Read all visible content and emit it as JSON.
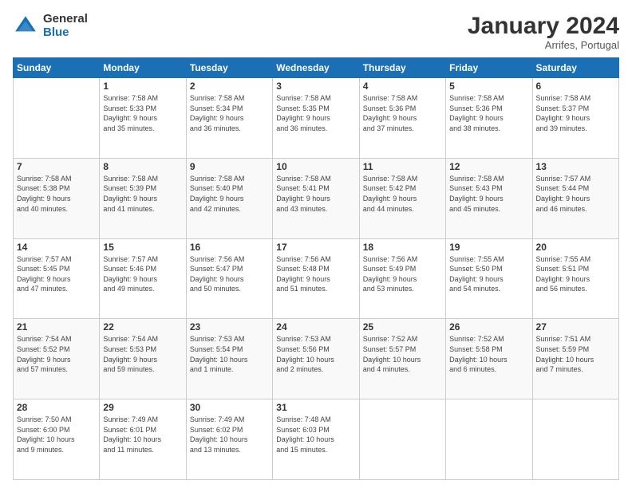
{
  "header": {
    "logo_general": "General",
    "logo_blue": "Blue",
    "month_title": "January 2024",
    "location": "Arrifes, Portugal"
  },
  "days_of_week": [
    "Sunday",
    "Monday",
    "Tuesday",
    "Wednesday",
    "Thursday",
    "Friday",
    "Saturday"
  ],
  "weeks": [
    [
      {
        "day": "",
        "info": ""
      },
      {
        "day": "1",
        "info": "Sunrise: 7:58 AM\nSunset: 5:33 PM\nDaylight: 9 hours\nand 35 minutes."
      },
      {
        "day": "2",
        "info": "Sunrise: 7:58 AM\nSunset: 5:34 PM\nDaylight: 9 hours\nand 36 minutes."
      },
      {
        "day": "3",
        "info": "Sunrise: 7:58 AM\nSunset: 5:35 PM\nDaylight: 9 hours\nand 36 minutes."
      },
      {
        "day": "4",
        "info": "Sunrise: 7:58 AM\nSunset: 5:36 PM\nDaylight: 9 hours\nand 37 minutes."
      },
      {
        "day": "5",
        "info": "Sunrise: 7:58 AM\nSunset: 5:36 PM\nDaylight: 9 hours\nand 38 minutes."
      },
      {
        "day": "6",
        "info": "Sunrise: 7:58 AM\nSunset: 5:37 PM\nDaylight: 9 hours\nand 39 minutes."
      }
    ],
    [
      {
        "day": "7",
        "info": "Sunrise: 7:58 AM\nSunset: 5:38 PM\nDaylight: 9 hours\nand 40 minutes."
      },
      {
        "day": "8",
        "info": "Sunrise: 7:58 AM\nSunset: 5:39 PM\nDaylight: 9 hours\nand 41 minutes."
      },
      {
        "day": "9",
        "info": "Sunrise: 7:58 AM\nSunset: 5:40 PM\nDaylight: 9 hours\nand 42 minutes."
      },
      {
        "day": "10",
        "info": "Sunrise: 7:58 AM\nSunset: 5:41 PM\nDaylight: 9 hours\nand 43 minutes."
      },
      {
        "day": "11",
        "info": "Sunrise: 7:58 AM\nSunset: 5:42 PM\nDaylight: 9 hours\nand 44 minutes."
      },
      {
        "day": "12",
        "info": "Sunrise: 7:58 AM\nSunset: 5:43 PM\nDaylight: 9 hours\nand 45 minutes."
      },
      {
        "day": "13",
        "info": "Sunrise: 7:57 AM\nSunset: 5:44 PM\nDaylight: 9 hours\nand 46 minutes."
      }
    ],
    [
      {
        "day": "14",
        "info": "Sunrise: 7:57 AM\nSunset: 5:45 PM\nDaylight: 9 hours\nand 47 minutes."
      },
      {
        "day": "15",
        "info": "Sunrise: 7:57 AM\nSunset: 5:46 PM\nDaylight: 9 hours\nand 49 minutes."
      },
      {
        "day": "16",
        "info": "Sunrise: 7:56 AM\nSunset: 5:47 PM\nDaylight: 9 hours\nand 50 minutes."
      },
      {
        "day": "17",
        "info": "Sunrise: 7:56 AM\nSunset: 5:48 PM\nDaylight: 9 hours\nand 51 minutes."
      },
      {
        "day": "18",
        "info": "Sunrise: 7:56 AM\nSunset: 5:49 PM\nDaylight: 9 hours\nand 53 minutes."
      },
      {
        "day": "19",
        "info": "Sunrise: 7:55 AM\nSunset: 5:50 PM\nDaylight: 9 hours\nand 54 minutes."
      },
      {
        "day": "20",
        "info": "Sunrise: 7:55 AM\nSunset: 5:51 PM\nDaylight: 9 hours\nand 56 minutes."
      }
    ],
    [
      {
        "day": "21",
        "info": "Sunrise: 7:54 AM\nSunset: 5:52 PM\nDaylight: 9 hours\nand 57 minutes."
      },
      {
        "day": "22",
        "info": "Sunrise: 7:54 AM\nSunset: 5:53 PM\nDaylight: 9 hours\nand 59 minutes."
      },
      {
        "day": "23",
        "info": "Sunrise: 7:53 AM\nSunset: 5:54 PM\nDaylight: 10 hours\nand 1 minute."
      },
      {
        "day": "24",
        "info": "Sunrise: 7:53 AM\nSunset: 5:56 PM\nDaylight: 10 hours\nand 2 minutes."
      },
      {
        "day": "25",
        "info": "Sunrise: 7:52 AM\nSunset: 5:57 PM\nDaylight: 10 hours\nand 4 minutes."
      },
      {
        "day": "26",
        "info": "Sunrise: 7:52 AM\nSunset: 5:58 PM\nDaylight: 10 hours\nand 6 minutes."
      },
      {
        "day": "27",
        "info": "Sunrise: 7:51 AM\nSunset: 5:59 PM\nDaylight: 10 hours\nand 7 minutes."
      }
    ],
    [
      {
        "day": "28",
        "info": "Sunrise: 7:50 AM\nSunset: 6:00 PM\nDaylight: 10 hours\nand 9 minutes."
      },
      {
        "day": "29",
        "info": "Sunrise: 7:49 AM\nSunset: 6:01 PM\nDaylight: 10 hours\nand 11 minutes."
      },
      {
        "day": "30",
        "info": "Sunrise: 7:49 AM\nSunset: 6:02 PM\nDaylight: 10 hours\nand 13 minutes."
      },
      {
        "day": "31",
        "info": "Sunrise: 7:48 AM\nSunset: 6:03 PM\nDaylight: 10 hours\nand 15 minutes."
      },
      {
        "day": "",
        "info": ""
      },
      {
        "day": "",
        "info": ""
      },
      {
        "day": "",
        "info": ""
      }
    ]
  ]
}
